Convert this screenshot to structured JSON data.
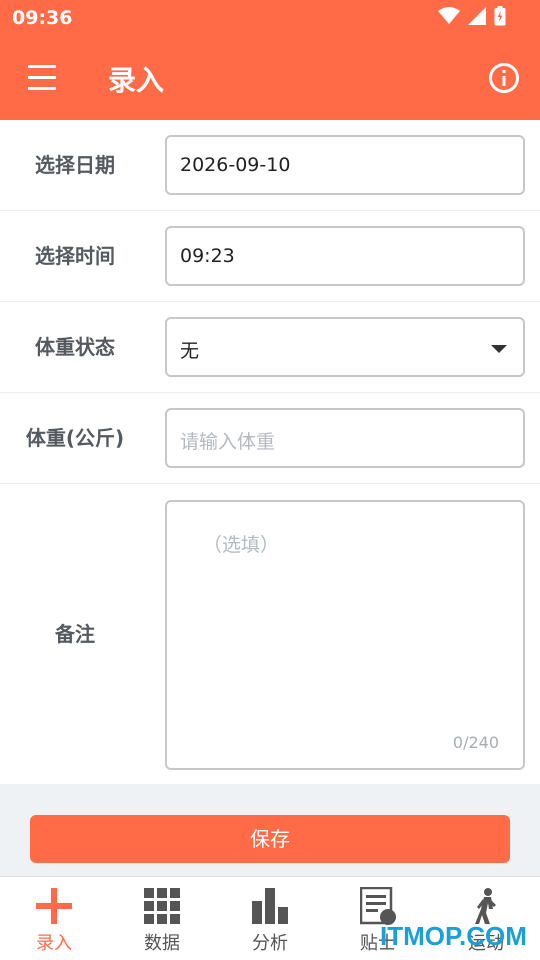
{
  "status": {
    "time": "09:36"
  },
  "appbar": {
    "title": "录入",
    "menu_icon": "menu-icon",
    "info_icon": "info-icon",
    "color": "#ff6b47"
  },
  "form": {
    "date": {
      "label": "选择日期",
      "value": "2026-09-10"
    },
    "time": {
      "label": "选择时间",
      "value": "09:23"
    },
    "state": {
      "label": "体重状态",
      "value": "无"
    },
    "weight": {
      "label": "体重(公斤)",
      "placeholder": "请输入体重"
    },
    "note": {
      "label": "备注",
      "placeholder": "（选填）",
      "counter": "0/240"
    }
  },
  "save_label": "保存",
  "bottom_nav": [
    {
      "label": "录入",
      "icon": "plus-icon",
      "active": true
    },
    {
      "label": "数据",
      "icon": "grid-icon",
      "active": false
    },
    {
      "label": "分析",
      "icon": "bar-chart-icon",
      "active": false
    },
    {
      "label": "贴士",
      "icon": "tips-icon",
      "active": false
    },
    {
      "label": "运动",
      "icon": "walk-icon",
      "active": false
    }
  ],
  "watermark": "ITMOP.COM"
}
